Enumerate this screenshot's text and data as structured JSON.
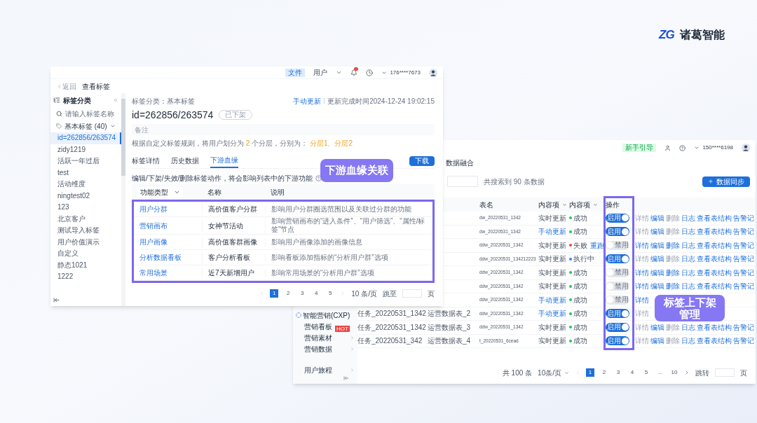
{
  "brand": {
    "mark": "ZG",
    "name": "诸葛智能"
  },
  "tag_window": {
    "header": {
      "badge": "文件",
      "menu": "用户",
      "user": "176****7673"
    },
    "back": "返回",
    "title": "查看标签",
    "sidebar": {
      "title": "标签分类",
      "search": {
        "placeholder": "请输入标签名称"
      },
      "group": {
        "label": "基本标签 (40)",
        "expanded": true
      },
      "items": [
        {
          "label": "id=262856/263574",
          "selected": true
        },
        {
          "label": "zidy1219",
          "selected": false
        },
        {
          "label": "活跃一年过后",
          "selected": false
        },
        {
          "label": "test",
          "selected": false
        },
        {
          "label": "活动维度",
          "selected": false
        },
        {
          "label": "ningtest02",
          "selected": false
        },
        {
          "label": "123",
          "selected": false
        },
        {
          "label": "北京客户",
          "selected": false
        },
        {
          "label": "测试导入标签",
          "selected": false
        },
        {
          "label": "用户价值演示",
          "selected": false
        },
        {
          "label": "自定义",
          "selected": false
        },
        {
          "label": "静态1021",
          "selected": false
        },
        {
          "label": "1222",
          "selected": false
        }
      ]
    },
    "breadcrumb": "标签分类：基本标签",
    "update_link": "手动更新",
    "update_time": "更新完成时间2024-12-24 19:02:15",
    "tag_id": "id=262856/263574",
    "status": "已下架",
    "remark": {
      "placeholder": "备注"
    },
    "rule": [
      {
        "text": "根据自定义标签规则，将用户划分为 ",
        "highlight": false
      },
      {
        "text": "2",
        "highlight": true
      },
      {
        "text": " 个分层，分别为： ",
        "highlight": false
      },
      {
        "text": "分层1、分层2",
        "highlight": true
      }
    ],
    "tabs": [
      {
        "label": "标签详情",
        "selected": false
      },
      {
        "label": "历史数据",
        "selected": false
      },
      {
        "label": "下游血缘",
        "selected": true
      }
    ],
    "download": "下载",
    "notice": "编辑/下架/失效/删除标签动作，将会影响列表中的下游功能",
    "table": {
      "columns": [
        "功能类型",
        "名称",
        "说明"
      ],
      "rows": [
        {
          "type": "用户分群",
          "name": "高价值客户分群",
          "description": "影响用户分群圈选范围以及关联过分群的功能"
        },
        {
          "type": "营销画布",
          "name": "女神节活动",
          "description": "影响营销画布的“进入条件”、“用户筛选”、“属性/标签”节点"
        },
        {
          "type": "用户画像",
          "name": "高价值客群画像",
          "description": "影响用户画像添加的画像信息"
        },
        {
          "type": "分析数据看板",
          "name": "客户分析看板",
          "description": "影响看板添加指标的“分析用户群”选项"
        },
        {
          "type": "常用场景",
          "name": "近7天新增用户",
          "description": "影响常用场景的“分析用户群”选项"
        }
      ]
    },
    "pagination": {
      "pages": [
        {
          "label": "1",
          "selected": true
        },
        {
          "label": "2",
          "selected": false
        },
        {
          "label": "3",
          "selected": false
        },
        {
          "label": "4",
          "selected": false
        },
        {
          "label": "5",
          "selected": false
        }
      ],
      "page_size": "10 条/页",
      "goto": "跳至",
      "unit": "页"
    }
  },
  "data_window": {
    "header": {
      "guide": "新手引导",
      "user": "150****6198"
    },
    "title": "数据融合",
    "result": "共搜索到 90 条数据",
    "sync": "数据同步",
    "sidebar": [
      {
        "label": "智能营销(CXP)",
        "kind": "group"
      },
      {
        "label": "营销看板",
        "kind": "item",
        "badge": "HOT"
      },
      {
        "label": "营销素材",
        "kind": "submenu"
      },
      {
        "label": "营销数据",
        "kind": "submenu"
      },
      {
        "label": "用户旅程",
        "kind": "submenu"
      }
    ],
    "columns": [
      "表名",
      "内容项",
      "内容项",
      "操作"
    ],
    "rows": [
      {
        "table": "dw_20220531_1342",
        "update": "实时更新",
        "manual": false,
        "status": "成功",
        "color": "#22c55e",
        "enabled": true,
        "toggle": "启用",
        "actions": [
          {
            "label": "详情",
            "disabled": true
          },
          {
            "label": "编辑",
            "disabled": false
          },
          {
            "label": "删除",
            "disabled": true
          },
          {
            "label": "日志",
            "disabled": false
          },
          {
            "label": "查看表结构",
            "disabled": false
          },
          {
            "label": "告警记",
            "disabled": false
          }
        ]
      },
      {
        "table": "dw_20220531_1342",
        "update": "手动更新",
        "manual": true,
        "status": "成功",
        "color": "#22c55e",
        "enabled": true,
        "toggle": "启用",
        "actions": [
          {
            "label": "详情",
            "disabled": true
          },
          {
            "label": "编辑",
            "disabled": false
          },
          {
            "label": "删除",
            "disabled": true
          },
          {
            "label": "日志",
            "disabled": false
          },
          {
            "label": "查看表结构",
            "disabled": false
          },
          {
            "label": "告警记",
            "disabled": false
          }
        ]
      },
      {
        "table": "ddw_20220531_1342",
        "update": "实时更新",
        "manual": false,
        "status": "失败",
        "color": "#ef4444",
        "retry": "重跑",
        "enabled": false,
        "toggle": "禁用",
        "actions": [
          {
            "label": "详情",
            "disabled": false
          },
          {
            "label": "编辑",
            "disabled": false
          },
          {
            "label": "删除",
            "disabled": false
          },
          {
            "label": "日志",
            "disabled": false
          },
          {
            "label": "查看表结构",
            "disabled": false
          },
          {
            "label": "告警记",
            "disabled": false
          }
        ]
      },
      {
        "table": "ddw_20220531_134212223",
        "update": "实时更新",
        "manual": false,
        "status": "执行中",
        "color": "#3b82f6",
        "enabled": true,
        "toggle": "启用",
        "actions": [
          {
            "label": "详情",
            "disabled": true
          },
          {
            "label": "编辑",
            "disabled": false
          },
          {
            "label": "删除",
            "disabled": true
          },
          {
            "label": "日志",
            "disabled": false
          },
          {
            "label": "查看表结构",
            "disabled": false
          },
          {
            "label": "告警记",
            "disabled": false
          }
        ]
      },
      {
        "table": "ddw_20220531_1342",
        "update": "实时更新",
        "manual": false,
        "status": "成功",
        "color": "#22c55e",
        "enabled": false,
        "toggle": "禁用",
        "actions": [
          {
            "label": "详情",
            "disabled": false
          },
          {
            "label": "编辑",
            "disabled": false
          },
          {
            "label": "删除",
            "disabled": false
          },
          {
            "label": "日志",
            "disabled": false
          },
          {
            "label": "查看表结构",
            "disabled": false
          },
          {
            "label": "告警记",
            "disabled": false
          }
        ]
      },
      {
        "table": "ddw_20220531_1342",
        "update": "实时更新",
        "manual": false,
        "status": "成功",
        "color": "#22c55e",
        "enabled": false,
        "toggle": "禁用",
        "actions": [
          {
            "label": "详情",
            "disabled": false
          },
          {
            "label": "编辑",
            "disabled": false
          },
          {
            "label": "删除",
            "disabled": false
          },
          {
            "label": "日志",
            "disabled": false
          },
          {
            "label": "查看表结构",
            "disabled": false
          },
          {
            "label": "告警记",
            "disabled": false
          }
        ]
      },
      {
        "table": "ddw_20220531_1342",
        "update": "手动更新",
        "manual": true,
        "status": "成功",
        "color": "#22c55e",
        "enabled": false,
        "toggle": "禁用",
        "actions": [
          {
            "label": "详情",
            "disabled": false
          }
        ]
      },
      {
        "task": "任务_20220531_1342",
        "source": "运营数据表_2",
        "table": "ddw_20220531_1342",
        "update": "手动更新",
        "manual": true,
        "status": "成功",
        "color": "#22c55e",
        "enabled": true,
        "toggle": "启用",
        "actions": [
          {
            "label": "详情",
            "disabled": true
          }
        ]
      },
      {
        "task": "任务_20220531_1342",
        "source": "运营数据表_3",
        "table": "ddw_20220531_1342",
        "update": "实时更新",
        "manual": false,
        "status": "成功",
        "color": "#22c55e",
        "enabled": true,
        "toggle": "启用",
        "actions": [
          {
            "label": "详情",
            "disabled": true
          },
          {
            "label": "编辑",
            "disabled": false
          },
          {
            "label": "删除",
            "disabled": true
          },
          {
            "label": "日志",
            "disabled": false
          },
          {
            "label": "查看表结构",
            "disabled": false
          },
          {
            "label": "告警记",
            "disabled": false
          }
        ]
      },
      {
        "task": "任务_20220531_342",
        "source": "运营数据表_4",
        "table": "t_20220531_6cead",
        "update": "实时更新",
        "manual": false,
        "status": "成功",
        "color": "#22c55e",
        "enabled": true,
        "toggle": "启用",
        "actions": [
          {
            "label": "详情",
            "disabled": true
          },
          {
            "label": "编辑",
            "disabled": false
          },
          {
            "label": "删除",
            "disabled": true
          },
          {
            "label": "日志",
            "disabled": false
          },
          {
            "label": "查看表结构",
            "disabled": false
          },
          {
            "label": "告警记",
            "disabled": false
          }
        ]
      }
    ],
    "pagination": {
      "total": "共 100 条",
      "page_size": "10条/页",
      "pages": [
        {
          "label": "1",
          "selected": true
        },
        {
          "label": "2",
          "selected": false
        },
        {
          "label": "3",
          "selected": false
        },
        {
          "label": "4",
          "selected": false
        },
        {
          "label": "5",
          "selected": false
        },
        {
          "label": "...",
          "selected": false
        },
        {
          "label": "10",
          "selected": false
        }
      ],
      "goto": "跳转",
      "unit": "页"
    }
  },
  "annotations": [
    {
      "text": "下游血缘关联"
    },
    {
      "text": "标签上下架管理"
    }
  ]
}
